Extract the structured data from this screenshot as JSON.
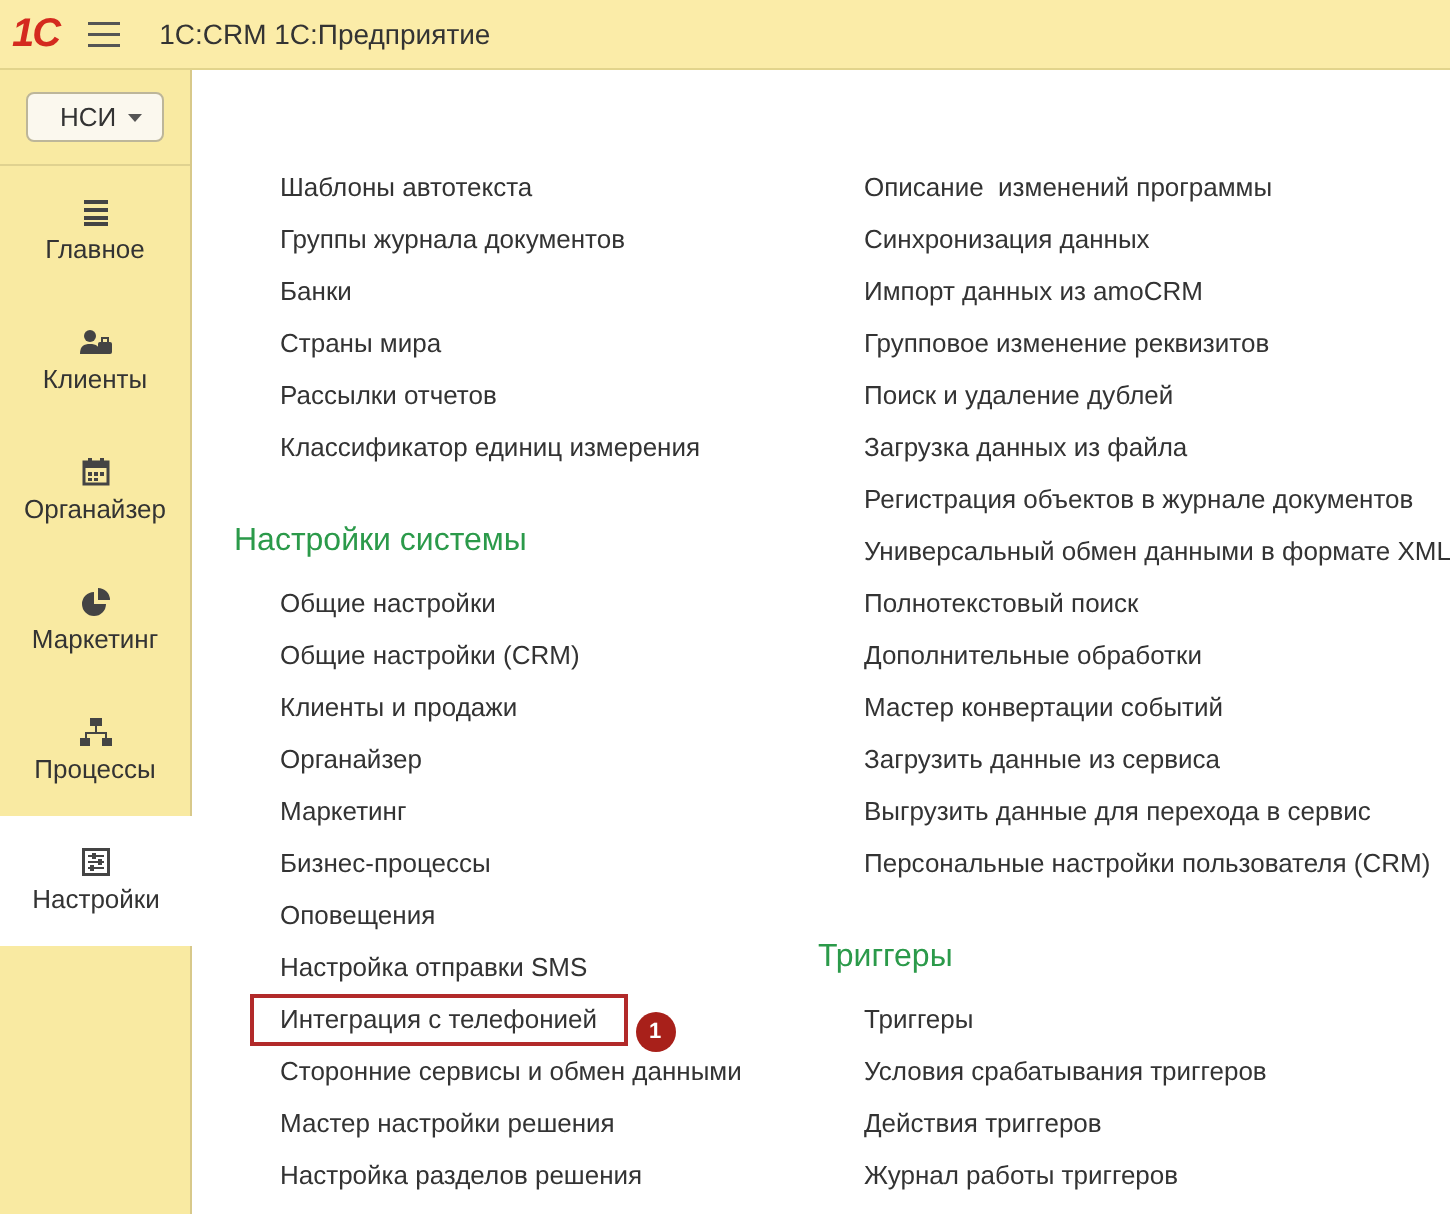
{
  "window": {
    "logo": "1С",
    "title": "1С:CRM 1С:Предприятие"
  },
  "sidebar": {
    "dropdown": {
      "label": "НСИ"
    },
    "items": [
      {
        "label": "Главное",
        "selected": false
      },
      {
        "label": "Клиенты",
        "selected": false
      },
      {
        "label": "Органайзер",
        "selected": false
      },
      {
        "label": "Маркетинг",
        "selected": false
      },
      {
        "label": "Процессы",
        "selected": false
      },
      {
        "label": "Настройки",
        "selected": true
      }
    ]
  },
  "columns": [
    {
      "groups": [
        {
          "items": [
            {
              "label": "Шаблоны автотекста",
              "highlighted": false
            },
            {
              "label": "Группы журнала документов",
              "highlighted": false
            },
            {
              "label": "Банки",
              "highlighted": false
            },
            {
              "label": "Страны мира",
              "highlighted": false
            },
            {
              "label": "Рассылки отчетов",
              "highlighted": false
            },
            {
              "label": "Классификатор единиц измерения",
              "highlighted": false
            }
          ]
        },
        {
          "heading": "Настройки системы",
          "items": [
            {
              "label": "Общие настройки",
              "highlighted": false
            },
            {
              "label": "Общие настройки (CRM)",
              "highlighted": false
            },
            {
              "label": "Клиенты и продажи",
              "highlighted": false
            },
            {
              "label": "Органайзер",
              "highlighted": false
            },
            {
              "label": "Маркетинг",
              "highlighted": false
            },
            {
              "label": "Бизнес-процессы",
              "highlighted": false
            },
            {
              "label": "Оповещения",
              "highlighted": false
            },
            {
              "label": "Настройка отправки SMS",
              "highlighted": false
            },
            {
              "label": "Интеграция с телефонией",
              "highlighted": true,
              "badge": "1"
            },
            {
              "label": "Сторонние сервисы и обмен данными",
              "highlighted": false
            },
            {
              "label": "Мастер настройки решения",
              "highlighted": false
            },
            {
              "label": "Настройка разделов решения",
              "highlighted": false
            }
          ]
        }
      ]
    },
    {
      "groups": [
        {
          "items": [
            {
              "label": "Описание  изменений программы",
              "highlighted": false
            },
            {
              "label": "Синхронизация данных",
              "highlighted": false
            },
            {
              "label": "Импорт данных из amoCRM",
              "highlighted": false
            },
            {
              "label": "Групповое изменение реквизитов",
              "highlighted": false
            },
            {
              "label": "Поиск и удаление дублей",
              "highlighted": false
            },
            {
              "label": "Загрузка данных из файла",
              "highlighted": false
            },
            {
              "label": "Регистрация объектов в журнале документов",
              "highlighted": false
            },
            {
              "label": "Универсальный обмен данными в формате XML",
              "highlighted": false
            },
            {
              "label": "Полнотекстовый поиск",
              "highlighted": false
            },
            {
              "label": "Дополнительные обработки",
              "highlighted": false
            },
            {
              "label": "Мастер конвертации событий",
              "highlighted": false
            },
            {
              "label": "Загрузить данные из сервиса",
              "highlighted": false
            },
            {
              "label": "Выгрузить данные для перехода в сервис",
              "highlighted": false
            },
            {
              "label": "Персональные настройки пользователя (CRM)",
              "highlighted": false
            }
          ]
        },
        {
          "heading": "Триггеры",
          "items": [
            {
              "label": "Триггеры",
              "highlighted": false
            },
            {
              "label": "Условия срабатывания триггеров",
              "highlighted": false
            },
            {
              "label": "Действия триггеров",
              "highlighted": false
            },
            {
              "label": "Журнал работы триггеров",
              "highlighted": false
            }
          ]
        }
      ]
    }
  ]
}
